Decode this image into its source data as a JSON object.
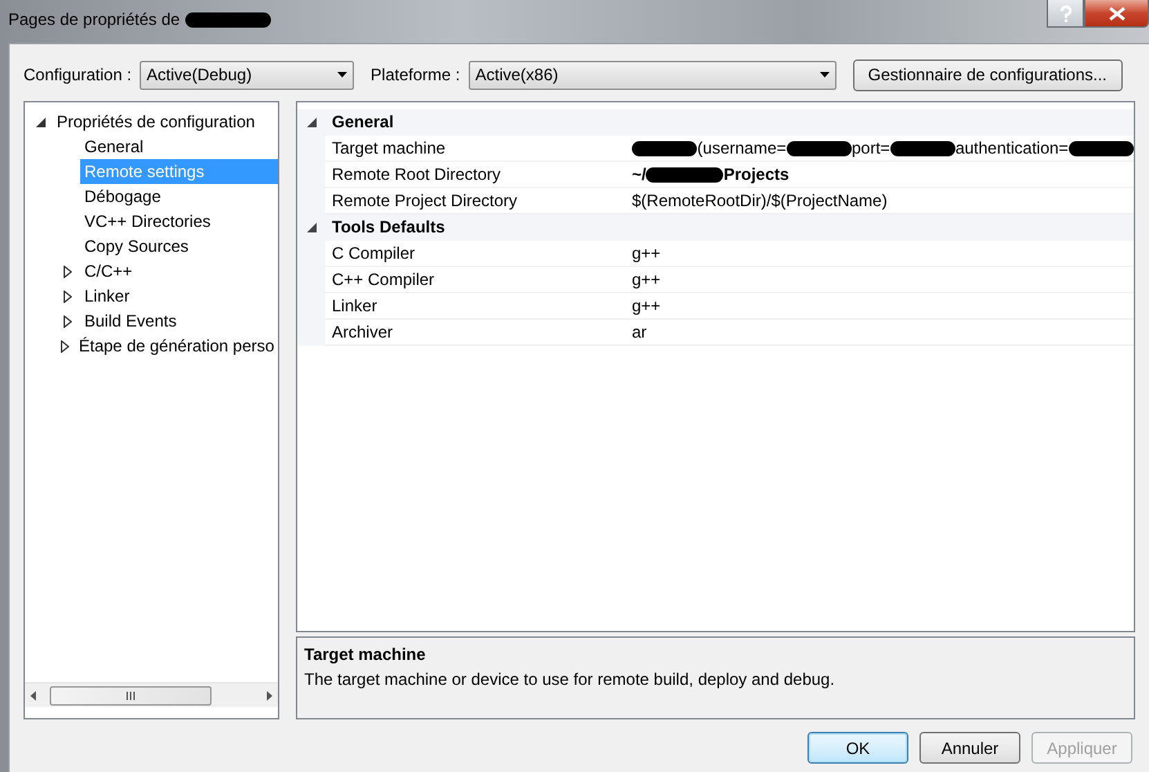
{
  "window": {
    "title": "Pages de propriétés de",
    "title_redacted": true
  },
  "toolbar": {
    "configuration_label": "Configuration :",
    "configuration_value": "Active(Debug)",
    "platform_label": "Plateforme :",
    "platform_value": "Active(x86)",
    "manager_button": "Gestionnaire de configurations..."
  },
  "tree": [
    {
      "label": "Propriétés de configuration",
      "expanded": true,
      "selected": false,
      "children": [
        {
          "label": "General",
          "selected": false
        },
        {
          "label": "Remote settings",
          "selected": true
        },
        {
          "label": "Débogage",
          "selected": false
        },
        {
          "label": "VC++ Directories",
          "selected": false
        },
        {
          "label": "Copy Sources",
          "selected": false
        },
        {
          "label": "C/C++",
          "expanded": false,
          "selected": false
        },
        {
          "label": "Linker",
          "expanded": false,
          "selected": false
        },
        {
          "label": "Build Events",
          "expanded": false,
          "selected": false
        },
        {
          "label": "Étape de génération perso",
          "expanded": false,
          "selected": false
        }
      ]
    }
  ],
  "grid": [
    {
      "category": "General",
      "expanded": true,
      "rows": [
        {
          "name": "Target machine",
          "bold": false,
          "value": [
            {
              "kind": "redacted"
            },
            {
              "kind": "text",
              "text": "(username="
            },
            {
              "kind": "redacted"
            },
            {
              "kind": "text",
              "text": "port="
            },
            {
              "kind": "redacted"
            },
            {
              "kind": "text",
              "text": " authentication="
            },
            {
              "kind": "redacted"
            }
          ]
        },
        {
          "name": "Remote Root Directory",
          "bold": true,
          "value": [
            {
              "kind": "text",
              "text": "~/"
            },
            {
              "kind": "redacted"
            },
            {
              "kind": "text",
              "text": "Projects"
            }
          ]
        },
        {
          "name": "Remote Project Directory",
          "bold": false,
          "value": [
            {
              "kind": "text",
              "text": "$(RemoteRootDir)/$(ProjectName)"
            }
          ]
        }
      ]
    },
    {
      "category": "Tools Defaults",
      "expanded": true,
      "rows": [
        {
          "name": "C Compiler",
          "bold": false,
          "value": [
            {
              "kind": "text",
              "text": "g++"
            }
          ]
        },
        {
          "name": "C++ Compiler",
          "bold": false,
          "value": [
            {
              "kind": "text",
              "text": "g++"
            }
          ]
        },
        {
          "name": "Linker",
          "bold": false,
          "value": [
            {
              "kind": "text",
              "text": "g++"
            }
          ]
        },
        {
          "name": "Archiver",
          "bold": false,
          "value": [
            {
              "kind": "text",
              "text": "ar"
            }
          ]
        }
      ]
    }
  ],
  "description": {
    "title": "Target machine",
    "text": "The target machine or device to use for remote build, deploy and debug."
  },
  "buttons": [
    {
      "label": "OK",
      "kind": "default",
      "disabled": false
    },
    {
      "label": "Annuler",
      "kind": "normal",
      "disabled": false
    },
    {
      "label": "Appliquer",
      "kind": "normal",
      "disabled": true
    }
  ]
}
